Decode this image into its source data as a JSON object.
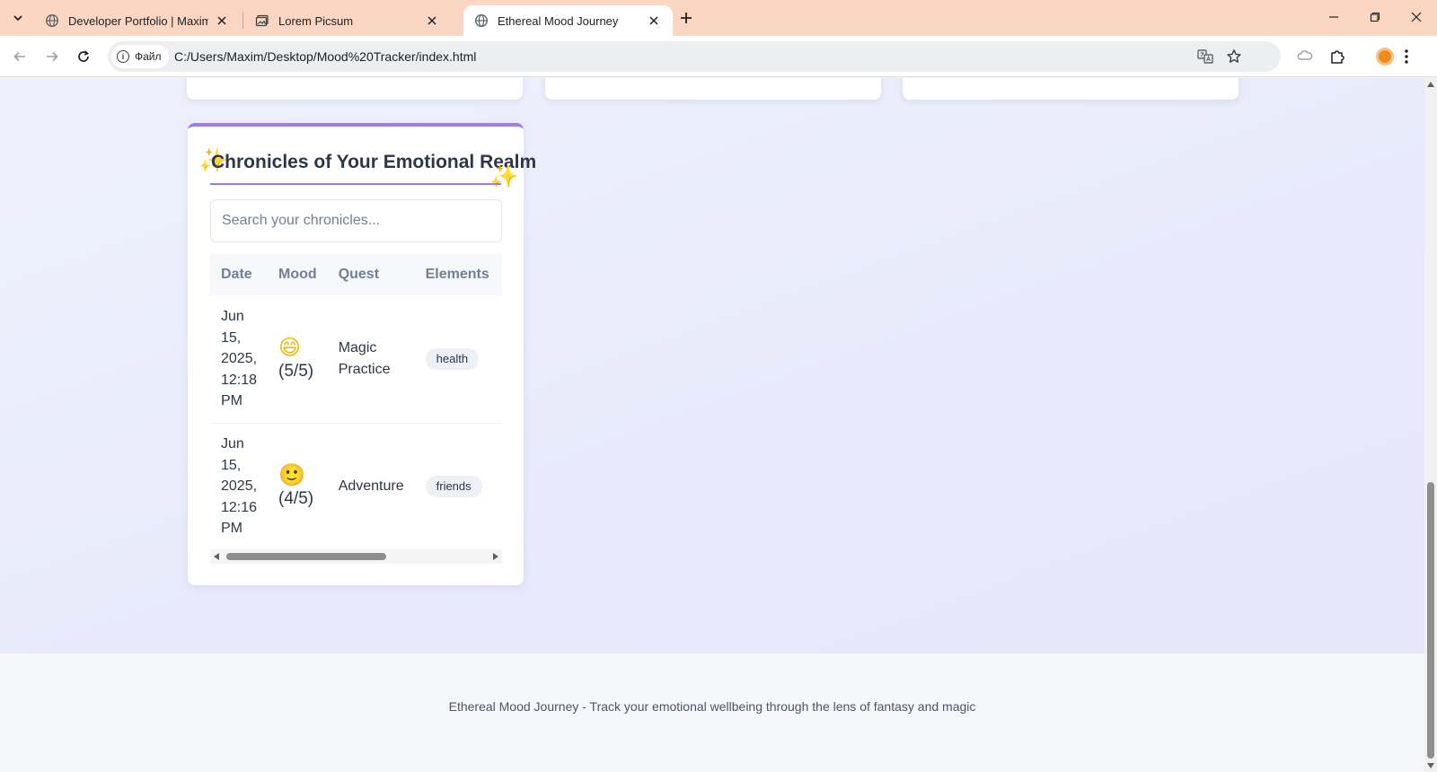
{
  "browser": {
    "tabs": [
      {
        "title": "Developer Portfolio | Maxim Mk",
        "active": false,
        "icon": "globe-icon"
      },
      {
        "title": "Lorem Picsum",
        "active": false,
        "icon": "image-icon"
      },
      {
        "title": "Ethereal Mood Journey",
        "active": true,
        "icon": "globe-icon"
      }
    ],
    "site_chip": "Файл",
    "url": "C:/Users/Maxim/Desktop/Mood%20Tracker/index.html"
  },
  "chronicles": {
    "title": "Chronicles of Your Emotional Realm",
    "sparkle": "✨",
    "search_placeholder": "Search your chronicles...",
    "columns": [
      "Date",
      "Mood",
      "Quest",
      "Elements"
    ],
    "rows": [
      {
        "date": "Jun 15, 2025, 12:18 PM",
        "emoji": "😄",
        "score": "(5/5)",
        "quest": "Magic Practice",
        "tag": "health"
      },
      {
        "date": "Jun 15, 2025, 12:16 PM",
        "emoji": "🙂",
        "score": "(4/5)",
        "quest": "Adventure",
        "tag": "friends"
      }
    ]
  },
  "footer": {
    "text": "Ethereal Mood Journey - Track your emotional wellbeing through the lens of fantasy and magic"
  },
  "colors": {
    "accent": "#9f7aea",
    "tab_strip": "#fbd7c3",
    "text_dark": "#2d3748",
    "text_muted": "#718096"
  }
}
